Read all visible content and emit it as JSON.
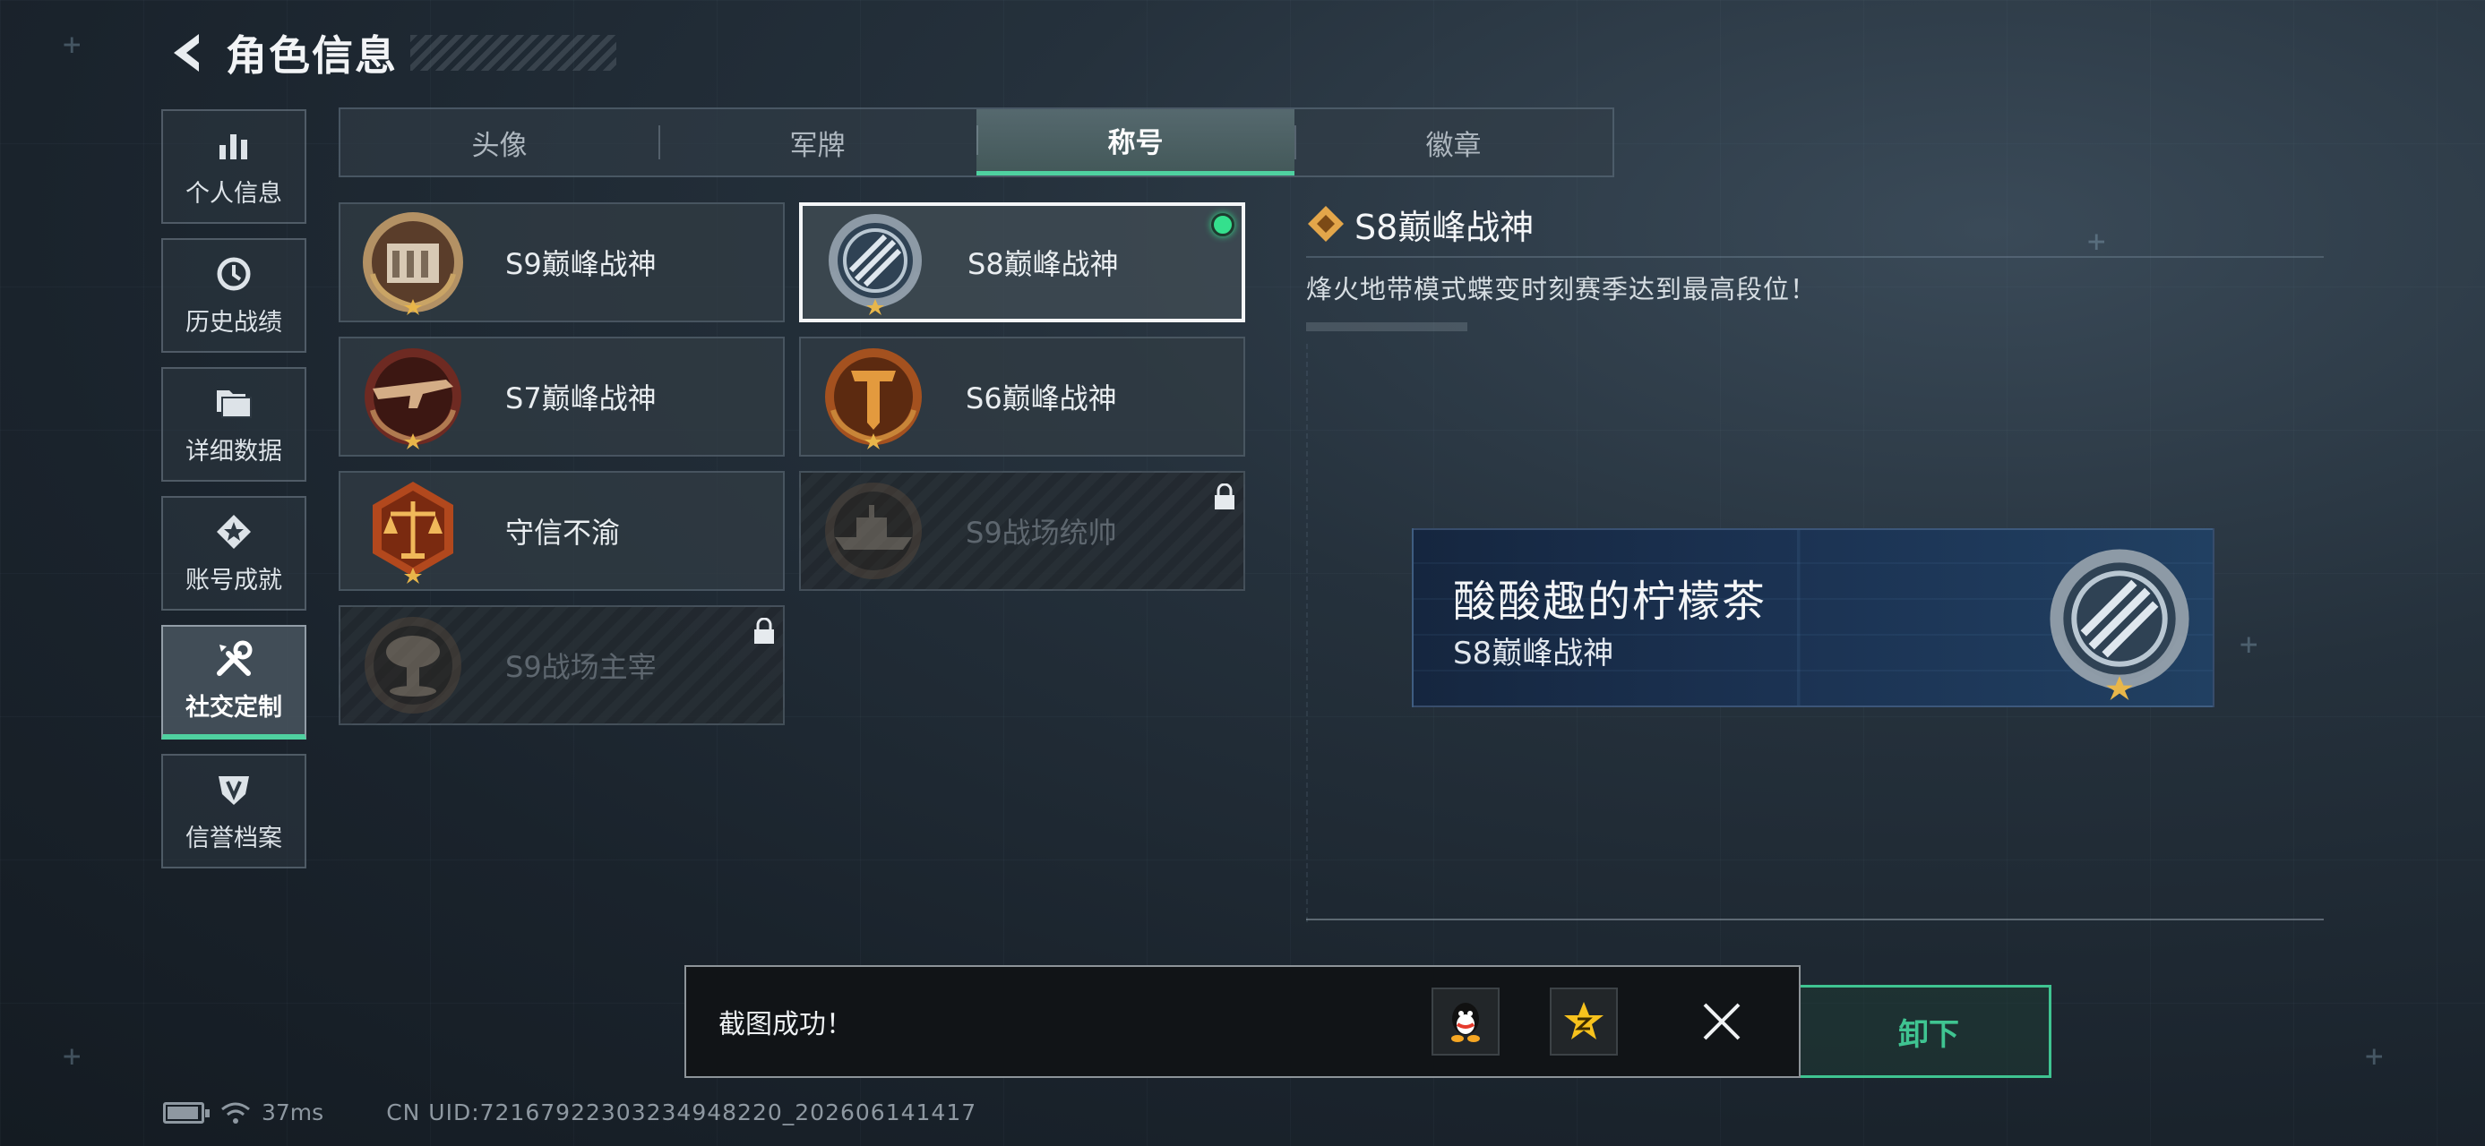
{
  "header": {
    "title": "角色信息"
  },
  "sidebar": {
    "items": [
      {
        "label": "个人信息",
        "icon": "bar-chart-icon",
        "active": false
      },
      {
        "label": "历史战绩",
        "icon": "history-clock-icon",
        "active": false
      },
      {
        "label": "详细数据",
        "icon": "folder-icon",
        "active": false
      },
      {
        "label": "账号成就",
        "icon": "achievement-icon",
        "active": false
      },
      {
        "label": "社交定制",
        "icon": "tools-icon",
        "active": true
      },
      {
        "label": "信誉档案",
        "icon": "shield-icon",
        "active": false
      }
    ]
  },
  "tabs": [
    {
      "label": "头像",
      "active": false
    },
    {
      "label": "军牌",
      "active": false
    },
    {
      "label": "称号",
      "active": true
    },
    {
      "label": "徽章",
      "active": false
    }
  ],
  "titles": [
    {
      "label": "S9巅峰战神",
      "badge": "building-emblem-icon",
      "locked": false,
      "selected": false
    },
    {
      "label": "S8巅峰战神",
      "badge": "crossed-blades-emblem-icon",
      "locked": false,
      "selected": true,
      "equipped": true
    },
    {
      "label": "S7巅峰战神",
      "badge": "rifle-emblem-icon",
      "locked": false,
      "selected": false
    },
    {
      "label": "S6巅峰战神",
      "badge": "t-shield-emblem-icon",
      "locked": false,
      "selected": false
    },
    {
      "label": "守信不渝",
      "badge": "scales-emblem-icon",
      "locked": false,
      "selected": false
    },
    {
      "label": "S9战场统帅",
      "badge": "battleship-emblem-icon",
      "locked": true,
      "selected": false
    },
    {
      "label": "S9战场主宰",
      "badge": "mushroom-cloud-emblem-icon",
      "locked": true,
      "selected": false
    }
  ],
  "detail": {
    "name": "S8巅峰战神",
    "description": "烽火地带模式蝶变时刻赛季达到最高段位！"
  },
  "nameplate": {
    "player_name": "酸酸趣的柠檬茶",
    "title": "S8巅峰战神"
  },
  "unequip_button": {
    "label": "卸下"
  },
  "toast": {
    "message": "截图成功！",
    "share_icons": [
      "qq-penguin-icon",
      "qzone-star-icon"
    ]
  },
  "status_bar": {
    "ping": "37ms",
    "uid": "CN UID:7216792230323494822​0_202606141417",
    "battery_level": 0.85
  },
  "colors": {
    "accent_green": "#4fd1a0",
    "equipped_dot": "#34e08d",
    "gold": "#e3a64a"
  }
}
